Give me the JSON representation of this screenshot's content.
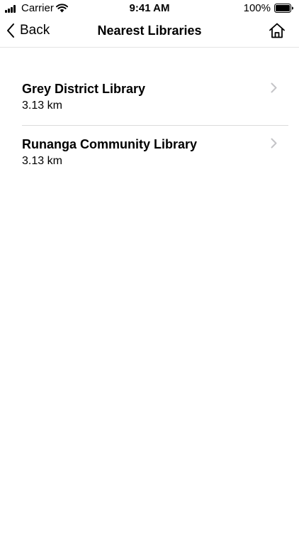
{
  "status_bar": {
    "carrier": "Carrier",
    "time": "9:41 AM",
    "battery": "100%"
  },
  "nav": {
    "back_label": "Back",
    "title": "Nearest Libraries",
    "home_icon": "home-icon",
    "back_icon": "chevron-left-icon"
  },
  "libraries": [
    {
      "name": "Grey District Library",
      "distance": "3.13 km"
    },
    {
      "name": "Runanga Community Library",
      "distance": "3.13 km"
    }
  ],
  "colors": {
    "text": "#000000",
    "separator": "#dcdcdc",
    "chevron": "#c4c4c7",
    "background": "#ffffff"
  }
}
